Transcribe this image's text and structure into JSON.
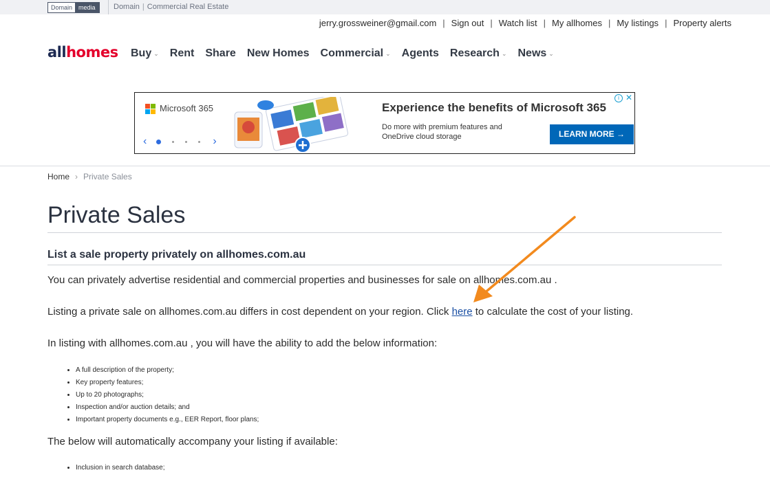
{
  "topbar": {
    "logo_part1": "Domain",
    "logo_part2": "media",
    "links": [
      "Domain",
      "Commercial Real Estate"
    ]
  },
  "user_links": [
    "jerry.grossweiner@gmail.com",
    "Sign out",
    "Watch list",
    "My allhomes",
    "My listings",
    "Property alerts"
  ],
  "brand": {
    "part1": "all",
    "part2": "homes"
  },
  "nav": [
    {
      "label": "Buy",
      "dropdown": true
    },
    {
      "label": "Rent",
      "dropdown": false
    },
    {
      "label": "Share",
      "dropdown": false
    },
    {
      "label": "New Homes",
      "dropdown": false
    },
    {
      "label": "Commercial",
      "dropdown": true
    },
    {
      "label": "Agents",
      "dropdown": false
    },
    {
      "label": "Research",
      "dropdown": true
    },
    {
      "label": "News",
      "dropdown": true
    }
  ],
  "ad": {
    "brand": "Microsoft 365",
    "headline": "Experience the benefits of Microsoft 365",
    "subline": "Do more with premium features and OneDrive cloud storage",
    "cta": "LEARN MORE →",
    "prev": "‹",
    "next": "›",
    "info": "i",
    "close": "✕"
  },
  "breadcrumb": {
    "home": "Home",
    "separator": "›",
    "current": "Private Sales"
  },
  "content": {
    "title": "Private Sales",
    "subheading": "List a sale property privately on allhomes.com.au",
    "para1": "You can privately advertise residential and commercial properties and businesses for sale on allhomes.com.au .",
    "para2_before": "Listing a private sale on allhomes.com.au differs in cost dependent on your region. Click ",
    "para2_link": "here",
    "para2_after": " to calculate the cost of your listing.",
    "para3": "In listing with allhomes.com.au , you will have the ability to add the below information:",
    "features": [
      "A full description of the property;",
      "Key property features;",
      "Up to 20 photographs;",
      "Inspection and/or auction details; and",
      "Important property documents e.g., EER Report, floor plans;"
    ],
    "para4": "The below will automatically accompany your listing if available:",
    "auto_items": [
      "Inclusion in search database;"
    ]
  },
  "colors": {
    "brand_navy": "#1d2a52",
    "brand_red": "#e4002b",
    "link_blue": "#1a4fa3",
    "annotation_arrow": "#f28a1e",
    "ms_red": "#f25022",
    "ms_green": "#7fba00",
    "ms_blue": "#00a4ef",
    "ms_yellow": "#ffb900"
  }
}
